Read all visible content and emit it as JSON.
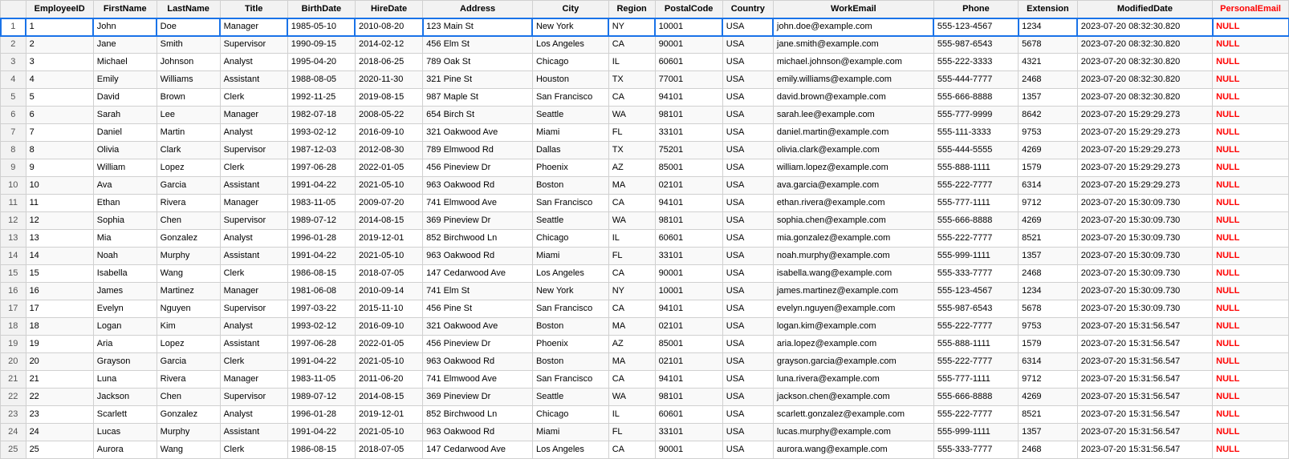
{
  "columns": [
    {
      "key": "rownum",
      "label": "",
      "class": ""
    },
    {
      "key": "EmployeeID",
      "label": "EmployeeID",
      "class": "col-employeeid"
    },
    {
      "key": "FirstName",
      "label": "FirstName",
      "class": "col-firstname"
    },
    {
      "key": "LastName",
      "label": "LastName",
      "class": "col-lastname"
    },
    {
      "key": "Title",
      "label": "Title",
      "class": "col-title"
    },
    {
      "key": "BirthDate",
      "label": "BirthDate",
      "class": "col-birthdate"
    },
    {
      "key": "HireDate",
      "label": "HireDate",
      "class": "col-hiredate"
    },
    {
      "key": "Address",
      "label": "Address",
      "class": "col-address"
    },
    {
      "key": "City",
      "label": "City",
      "class": "col-city"
    },
    {
      "key": "Region",
      "label": "Region",
      "class": "col-region"
    },
    {
      "key": "PostalCode",
      "label": "PostalCode",
      "class": "col-postalcode"
    },
    {
      "key": "Country",
      "label": "Country",
      "class": "col-country"
    },
    {
      "key": "WorkEmail",
      "label": "WorkEmail",
      "class": "col-workemail"
    },
    {
      "key": "Phone",
      "label": "Phone",
      "class": "col-phone"
    },
    {
      "key": "Extension",
      "label": "Extension",
      "class": "col-extension"
    },
    {
      "key": "ModifiedDate",
      "label": "ModifiedDate",
      "class": "col-modifieddate"
    },
    {
      "key": "PersonalEmail",
      "label": "PersonalEmail",
      "class": "col-personalemail"
    }
  ],
  "rows": [
    {
      "rownum": 1,
      "EmployeeID": "1",
      "FirstName": "John",
      "LastName": "Doe",
      "Title": "Manager",
      "BirthDate": "1985-05-10",
      "HireDate": "2010-08-20",
      "Address": "123 Main St",
      "City": "New York",
      "Region": "NY",
      "PostalCode": "10001",
      "Country": "USA",
      "WorkEmail": "john.doe@example.com",
      "Phone": "555-123-4567",
      "Extension": "1234",
      "ModifiedDate": "2023-07-20 08:32:30.820",
      "PersonalEmail": "NULL",
      "selected": true
    },
    {
      "rownum": 2,
      "EmployeeID": "2",
      "FirstName": "Jane",
      "LastName": "Smith",
      "Title": "Supervisor",
      "BirthDate": "1990-09-15",
      "HireDate": "2014-02-12",
      "Address": "456 Elm St",
      "City": "Los Angeles",
      "Region": "CA",
      "PostalCode": "90001",
      "Country": "USA",
      "WorkEmail": "jane.smith@example.com",
      "Phone": "555-987-6543",
      "Extension": "5678",
      "ModifiedDate": "2023-07-20 08:32:30.820",
      "PersonalEmail": "NULL"
    },
    {
      "rownum": 3,
      "EmployeeID": "3",
      "FirstName": "Michael",
      "LastName": "Johnson",
      "Title": "Analyst",
      "BirthDate": "1995-04-20",
      "HireDate": "2018-06-25",
      "Address": "789 Oak St",
      "City": "Chicago",
      "Region": "IL",
      "PostalCode": "60601",
      "Country": "USA",
      "WorkEmail": "michael.johnson@example.com",
      "Phone": "555-222-3333",
      "Extension": "4321",
      "ModifiedDate": "2023-07-20 08:32:30.820",
      "PersonalEmail": "NULL"
    },
    {
      "rownum": 4,
      "EmployeeID": "4",
      "FirstName": "Emily",
      "LastName": "Williams",
      "Title": "Assistant",
      "BirthDate": "1988-08-05",
      "HireDate": "2020-11-30",
      "Address": "321 Pine St",
      "City": "Houston",
      "Region": "TX",
      "PostalCode": "77001",
      "Country": "USA",
      "WorkEmail": "emily.williams@example.com",
      "Phone": "555-444-7777",
      "Extension": "2468",
      "ModifiedDate": "2023-07-20 08:32:30.820",
      "PersonalEmail": "NULL"
    },
    {
      "rownum": 5,
      "EmployeeID": "5",
      "FirstName": "David",
      "LastName": "Brown",
      "Title": "Clerk",
      "BirthDate": "1992-11-25",
      "HireDate": "2019-08-15",
      "Address": "987 Maple St",
      "City": "San Francisco",
      "Region": "CA",
      "PostalCode": "94101",
      "Country": "USA",
      "WorkEmail": "david.brown@example.com",
      "Phone": "555-666-8888",
      "Extension": "1357",
      "ModifiedDate": "2023-07-20 08:32:30.820",
      "PersonalEmail": "NULL"
    },
    {
      "rownum": 6,
      "EmployeeID": "6",
      "FirstName": "Sarah",
      "LastName": "Lee",
      "Title": "Manager",
      "BirthDate": "1982-07-18",
      "HireDate": "2008-05-22",
      "Address": "654 Birch St",
      "City": "Seattle",
      "Region": "WA",
      "PostalCode": "98101",
      "Country": "USA",
      "WorkEmail": "sarah.lee@example.com",
      "Phone": "555-777-9999",
      "Extension": "8642",
      "ModifiedDate": "2023-07-20 15:29:29.273",
      "PersonalEmail": "NULL"
    },
    {
      "rownum": 7,
      "EmployeeID": "7",
      "FirstName": "Daniel",
      "LastName": "Martin",
      "Title": "Analyst",
      "BirthDate": "1993-02-12",
      "HireDate": "2016-09-10",
      "Address": "321 Oakwood Ave",
      "City": "Miami",
      "Region": "FL",
      "PostalCode": "33101",
      "Country": "USA",
      "WorkEmail": "daniel.martin@example.com",
      "Phone": "555-111-3333",
      "Extension": "9753",
      "ModifiedDate": "2023-07-20 15:29:29.273",
      "PersonalEmail": "NULL"
    },
    {
      "rownum": 8,
      "EmployeeID": "8",
      "FirstName": "Olivia",
      "LastName": "Clark",
      "Title": "Supervisor",
      "BirthDate": "1987-12-03",
      "HireDate": "2012-08-30",
      "Address": "789 Elmwood Rd",
      "City": "Dallas",
      "Region": "TX",
      "PostalCode": "75201",
      "Country": "USA",
      "WorkEmail": "olivia.clark@example.com",
      "Phone": "555-444-5555",
      "Extension": "4269",
      "ModifiedDate": "2023-07-20 15:29:29.273",
      "PersonalEmail": "NULL"
    },
    {
      "rownum": 9,
      "EmployeeID": "9",
      "FirstName": "William",
      "LastName": "Lopez",
      "Title": "Clerk",
      "BirthDate": "1997-06-28",
      "HireDate": "2022-01-05",
      "Address": "456 Pineview Dr",
      "City": "Phoenix",
      "Region": "AZ",
      "PostalCode": "85001",
      "Country": "USA",
      "WorkEmail": "william.lopez@example.com",
      "Phone": "555-888-1111",
      "Extension": "1579",
      "ModifiedDate": "2023-07-20 15:29:29.273",
      "PersonalEmail": "NULL"
    },
    {
      "rownum": 10,
      "EmployeeID": "10",
      "FirstName": "Ava",
      "LastName": "Garcia",
      "Title": "Assistant",
      "BirthDate": "1991-04-22",
      "HireDate": "2021-05-10",
      "Address": "963 Oakwood Rd",
      "City": "Boston",
      "Region": "MA",
      "PostalCode": "02101",
      "Country": "USA",
      "WorkEmail": "ava.garcia@example.com",
      "Phone": "555-222-7777",
      "Extension": "6314",
      "ModifiedDate": "2023-07-20 15:29:29.273",
      "PersonalEmail": "NULL"
    },
    {
      "rownum": 11,
      "EmployeeID": "11",
      "FirstName": "Ethan",
      "LastName": "Rivera",
      "Title": "Manager",
      "BirthDate": "1983-11-05",
      "HireDate": "2009-07-20",
      "Address": "741 Elmwood Ave",
      "City": "San Francisco",
      "Region": "CA",
      "PostalCode": "94101",
      "Country": "USA",
      "WorkEmail": "ethan.rivera@example.com",
      "Phone": "555-777-1111",
      "Extension": "9712",
      "ModifiedDate": "2023-07-20 15:30:09.730",
      "PersonalEmail": "NULL"
    },
    {
      "rownum": 12,
      "EmployeeID": "12",
      "FirstName": "Sophia",
      "LastName": "Chen",
      "Title": "Supervisor",
      "BirthDate": "1989-07-12",
      "HireDate": "2014-08-15",
      "Address": "369 Pineview Dr",
      "City": "Seattle",
      "Region": "WA",
      "PostalCode": "98101",
      "Country": "USA",
      "WorkEmail": "sophia.chen@example.com",
      "Phone": "555-666-8888",
      "Extension": "4269",
      "ModifiedDate": "2023-07-20 15:30:09.730",
      "PersonalEmail": "NULL"
    },
    {
      "rownum": 13,
      "EmployeeID": "13",
      "FirstName": "Mia",
      "LastName": "Gonzalez",
      "Title": "Analyst",
      "BirthDate": "1996-01-28",
      "HireDate": "2019-12-01",
      "Address": "852 Birchwood Ln",
      "City": "Chicago",
      "Region": "IL",
      "PostalCode": "60601",
      "Country": "USA",
      "WorkEmail": "mia.gonzalez@example.com",
      "Phone": "555-222-7777",
      "Extension": "8521",
      "ModifiedDate": "2023-07-20 15:30:09.730",
      "PersonalEmail": "NULL"
    },
    {
      "rownum": 14,
      "EmployeeID": "14",
      "FirstName": "Noah",
      "LastName": "Murphy",
      "Title": "Assistant",
      "BirthDate": "1991-04-22",
      "HireDate": "2021-05-10",
      "Address": "963 Oakwood Rd",
      "City": "Miami",
      "Region": "FL",
      "PostalCode": "33101",
      "Country": "USA",
      "WorkEmail": "noah.murphy@example.com",
      "Phone": "555-999-1111",
      "Extension": "1357",
      "ModifiedDate": "2023-07-20 15:30:09.730",
      "PersonalEmail": "NULL"
    },
    {
      "rownum": 15,
      "EmployeeID": "15",
      "FirstName": "Isabella",
      "LastName": "Wang",
      "Title": "Clerk",
      "BirthDate": "1986-08-15",
      "HireDate": "2018-07-05",
      "Address": "147 Cedarwood Ave",
      "City": "Los Angeles",
      "Region": "CA",
      "PostalCode": "90001",
      "Country": "USA",
      "WorkEmail": "isabella.wang@example.com",
      "Phone": "555-333-7777",
      "Extension": "2468",
      "ModifiedDate": "2023-07-20 15:30:09.730",
      "PersonalEmail": "NULL"
    },
    {
      "rownum": 16,
      "EmployeeID": "16",
      "FirstName": "James",
      "LastName": "Martinez",
      "Title": "Manager",
      "BirthDate": "1981-06-08",
      "HireDate": "2010-09-14",
      "Address": "741 Elm St",
      "City": "New York",
      "Region": "NY",
      "PostalCode": "10001",
      "Country": "USA",
      "WorkEmail": "james.martinez@example.com",
      "Phone": "555-123-4567",
      "Extension": "1234",
      "ModifiedDate": "2023-07-20 15:30:09.730",
      "PersonalEmail": "NULL"
    },
    {
      "rownum": 17,
      "EmployeeID": "17",
      "FirstName": "Evelyn",
      "LastName": "Nguyen",
      "Title": "Supervisor",
      "BirthDate": "1997-03-22",
      "HireDate": "2015-11-10",
      "Address": "456 Pine St",
      "City": "San Francisco",
      "Region": "CA",
      "PostalCode": "94101",
      "Country": "USA",
      "WorkEmail": "evelyn.nguyen@example.com",
      "Phone": "555-987-6543",
      "Extension": "5678",
      "ModifiedDate": "2023-07-20 15:30:09.730",
      "PersonalEmail": "NULL"
    },
    {
      "rownum": 18,
      "EmployeeID": "18",
      "FirstName": "Logan",
      "LastName": "Kim",
      "Title": "Analyst",
      "BirthDate": "1993-02-12",
      "HireDate": "2016-09-10",
      "Address": "321 Oakwood Ave",
      "City": "Boston",
      "Region": "MA",
      "PostalCode": "02101",
      "Country": "USA",
      "WorkEmail": "logan.kim@example.com",
      "Phone": "555-222-7777",
      "Extension": "9753",
      "ModifiedDate": "2023-07-20 15:31:56.547",
      "PersonalEmail": "NULL"
    },
    {
      "rownum": 19,
      "EmployeeID": "19",
      "FirstName": "Aria",
      "LastName": "Lopez",
      "Title": "Assistant",
      "BirthDate": "1997-06-28",
      "HireDate": "2022-01-05",
      "Address": "456 Pineview Dr",
      "City": "Phoenix",
      "Region": "AZ",
      "PostalCode": "85001",
      "Country": "USA",
      "WorkEmail": "aria.lopez@example.com",
      "Phone": "555-888-1111",
      "Extension": "1579",
      "ModifiedDate": "2023-07-20 15:31:56.547",
      "PersonalEmail": "NULL"
    },
    {
      "rownum": 20,
      "EmployeeID": "20",
      "FirstName": "Grayson",
      "LastName": "Garcia",
      "Title": "Clerk",
      "BirthDate": "1991-04-22",
      "HireDate": "2021-05-10",
      "Address": "963 Oakwood Rd",
      "City": "Boston",
      "Region": "MA",
      "PostalCode": "02101",
      "Country": "USA",
      "WorkEmail": "grayson.garcia@example.com",
      "Phone": "555-222-7777",
      "Extension": "6314",
      "ModifiedDate": "2023-07-20 15:31:56.547",
      "PersonalEmail": "NULL"
    },
    {
      "rownum": 21,
      "EmployeeID": "21",
      "FirstName": "Luna",
      "LastName": "Rivera",
      "Title": "Manager",
      "BirthDate": "1983-11-05",
      "HireDate": "2011-06-20",
      "Address": "741 Elmwood Ave",
      "City": "San Francisco",
      "Region": "CA",
      "PostalCode": "94101",
      "Country": "USA",
      "WorkEmail": "luna.rivera@example.com",
      "Phone": "555-777-1111",
      "Extension": "9712",
      "ModifiedDate": "2023-07-20 15:31:56.547",
      "PersonalEmail": "NULL"
    },
    {
      "rownum": 22,
      "EmployeeID": "22",
      "FirstName": "Jackson",
      "LastName": "Chen",
      "Title": "Supervisor",
      "BirthDate": "1989-07-12",
      "HireDate": "2014-08-15",
      "Address": "369 Pineview Dr",
      "City": "Seattle",
      "Region": "WA",
      "PostalCode": "98101",
      "Country": "USA",
      "WorkEmail": "jackson.chen@example.com",
      "Phone": "555-666-8888",
      "Extension": "4269",
      "ModifiedDate": "2023-07-20 15:31:56.547",
      "PersonalEmail": "NULL"
    },
    {
      "rownum": 23,
      "EmployeeID": "23",
      "FirstName": "Scarlett",
      "LastName": "Gonzalez",
      "Title": "Analyst",
      "BirthDate": "1996-01-28",
      "HireDate": "2019-12-01",
      "Address": "852 Birchwood Ln",
      "City": "Chicago",
      "Region": "IL",
      "PostalCode": "60601",
      "Country": "USA",
      "WorkEmail": "scarlett.gonzalez@example.com",
      "Phone": "555-222-7777",
      "Extension": "8521",
      "ModifiedDate": "2023-07-20 15:31:56.547",
      "PersonalEmail": "NULL"
    },
    {
      "rownum": 24,
      "EmployeeID": "24",
      "FirstName": "Lucas",
      "LastName": "Murphy",
      "Title": "Assistant",
      "BirthDate": "1991-04-22",
      "HireDate": "2021-05-10",
      "Address": "963 Oakwood Rd",
      "City": "Miami",
      "Region": "FL",
      "PostalCode": "33101",
      "Country": "USA",
      "WorkEmail": "lucas.murphy@example.com",
      "Phone": "555-999-1111",
      "Extension": "1357",
      "ModifiedDate": "2023-07-20 15:31:56.547",
      "PersonalEmail": "NULL"
    },
    {
      "rownum": 25,
      "EmployeeID": "25",
      "FirstName": "Aurora",
      "LastName": "Wang",
      "Title": "Clerk",
      "BirthDate": "1986-08-15",
      "HireDate": "2018-07-05",
      "Address": "147 Cedarwood Ave",
      "City": "Los Angeles",
      "Region": "CA",
      "PostalCode": "90001",
      "Country": "USA",
      "WorkEmail": "aurora.wang@example.com",
      "Phone": "555-333-7777",
      "Extension": "2468",
      "ModifiedDate": "2023-07-20 15:31:56.547",
      "PersonalEmail": "NULL"
    }
  ]
}
